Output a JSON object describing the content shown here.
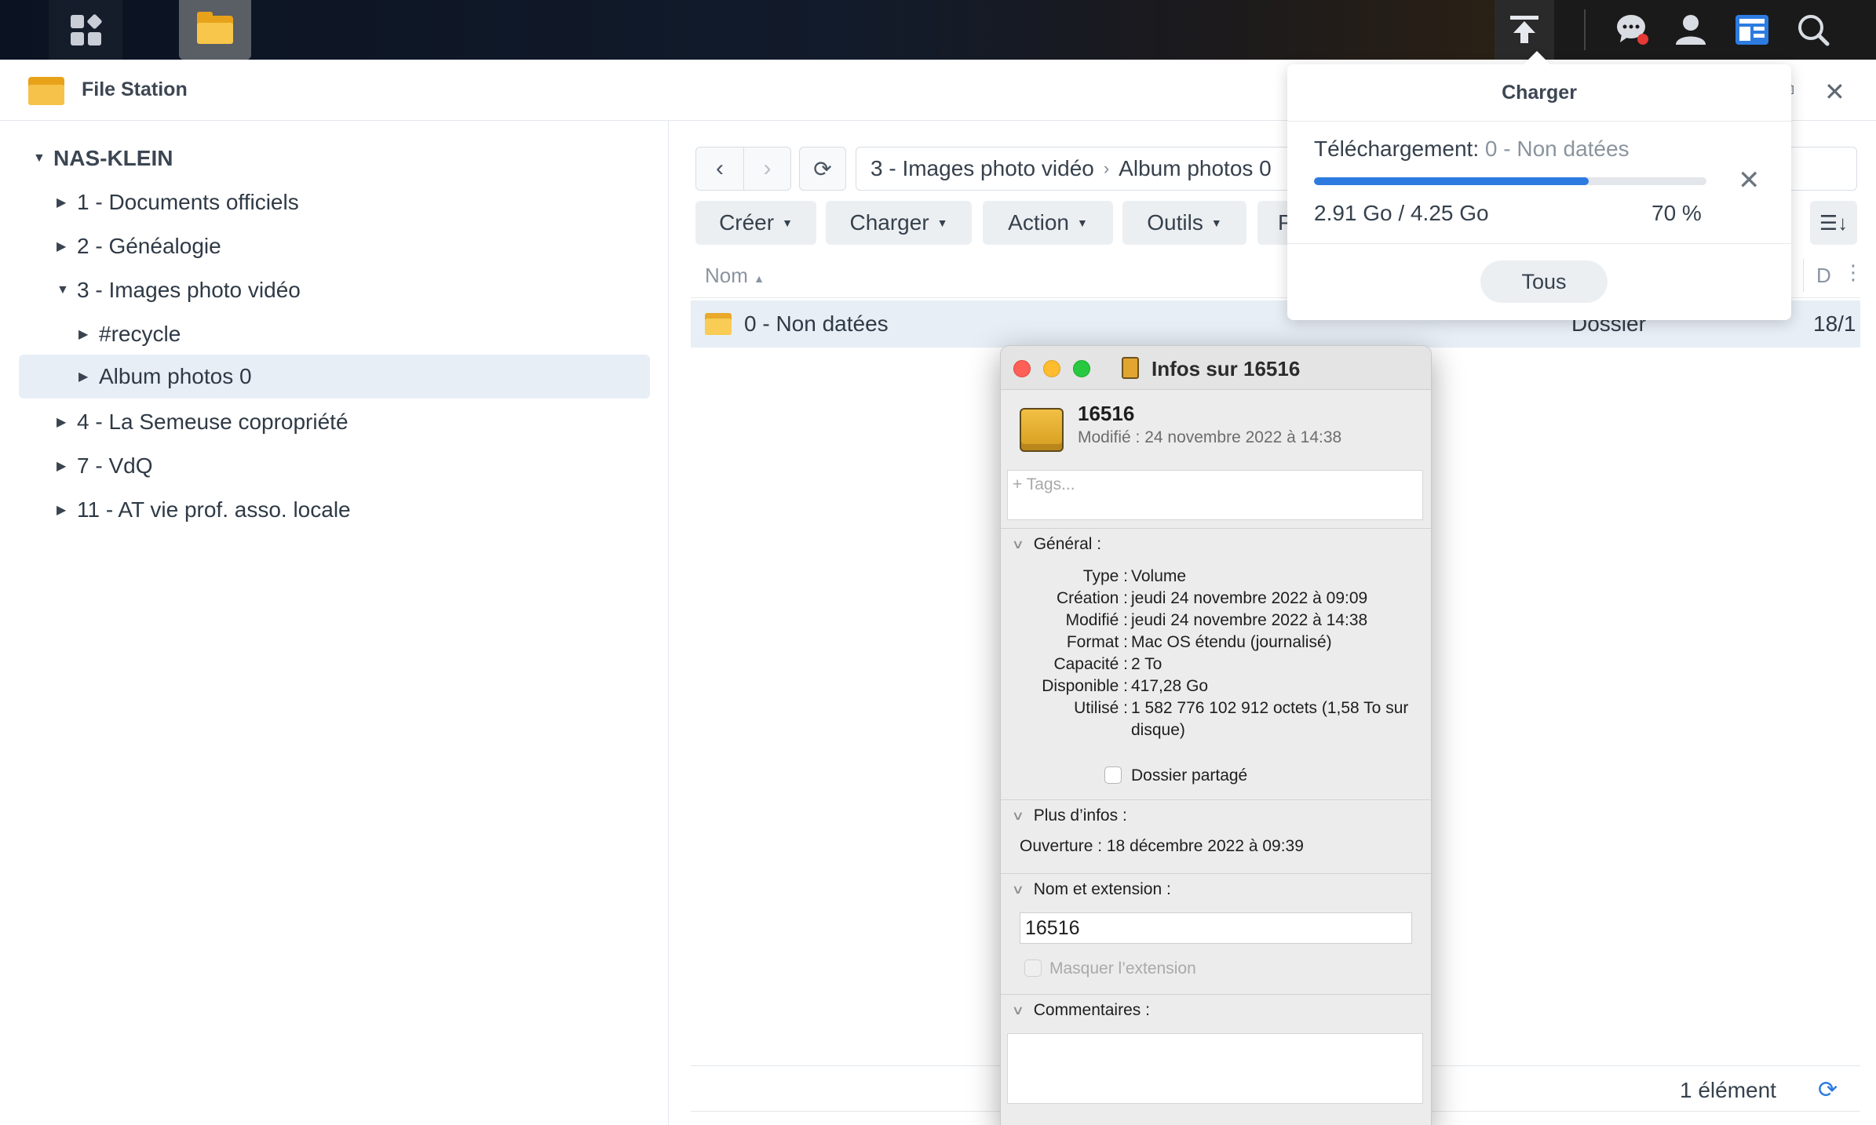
{
  "taskbar": {
    "apps_icon": "grid-icon",
    "filestation_icon": "folder-icon",
    "right_icons": [
      "upload-icon",
      "chat-icon",
      "user-icon",
      "widgets-icon",
      "search-icon"
    ]
  },
  "window": {
    "title": "File Station",
    "close_icon": "✕",
    "restore_icon": "⧉"
  },
  "tree": {
    "root": "NAS-KLEIN",
    "items": [
      {
        "label": "1 - Documents officiels"
      },
      {
        "label": "2 - Généalogie"
      },
      {
        "label": "3 - Images photo vidéo"
      },
      {
        "label": "#recycle"
      },
      {
        "label": "Album photos 0"
      },
      {
        "label": "4 - La Semeuse copropriété"
      },
      {
        "label": "7 - VdQ"
      },
      {
        "label": "11 - AT vie prof. asso. locale"
      }
    ]
  },
  "toolbar": {
    "path_part1": "3 - Images photo vidéo",
    "path_part2": "Album photos 0",
    "buttons": {
      "create": "Créer",
      "upload": "Charger",
      "action": "Action",
      "tools": "Outils",
      "partial": "P"
    }
  },
  "list": {
    "col_name": "Nom",
    "col_date": "D",
    "rows": [
      {
        "name": "0 - Non datées",
        "type": "Dossier",
        "date": "18/1"
      }
    ],
    "footer_count": "1 élément"
  },
  "upload_popover": {
    "title": "Charger",
    "label": "Téléchargement:",
    "current": "0 - Non datées",
    "sizes": "2.91 Go / 4.25 Go",
    "percent_text": "70 %",
    "progress": 0.7,
    "all_button": "Tous"
  },
  "info_window": {
    "title": "Infos sur 16516",
    "name": "16516",
    "modified_line": "Modifié : 24 novembre 2022 à 14:38",
    "tags_placeholder": "+ Tags...",
    "general_header": "Général :",
    "general": [
      {
        "k": "Type :",
        "v": "Volume"
      },
      {
        "k": "Création :",
        "v": "jeudi 24 novembre 2022 à 09:09"
      },
      {
        "k": "Modifié :",
        "v": "jeudi 24 novembre 2022 à 14:38"
      },
      {
        "k": "Format :",
        "v": "Mac OS étendu (journalisé)"
      },
      {
        "k": "Capacité :",
        "v": "2 To"
      },
      {
        "k": "Disponible :",
        "v": "417,28 Go"
      },
      {
        "k": "Utilisé :",
        "v": "1 582 776 102 912 octets (1,58 To sur disque)"
      }
    ],
    "shared_folder": "Dossier partagé",
    "more_header": "Plus d’infos :",
    "opened": "Ouverture : 18 décembre 2022 à 09:39",
    "name_ext_header": "Nom et extension :",
    "name_value": "16516",
    "hide_ext": "Masquer l’extension",
    "comments_header": "Commentaires :"
  }
}
